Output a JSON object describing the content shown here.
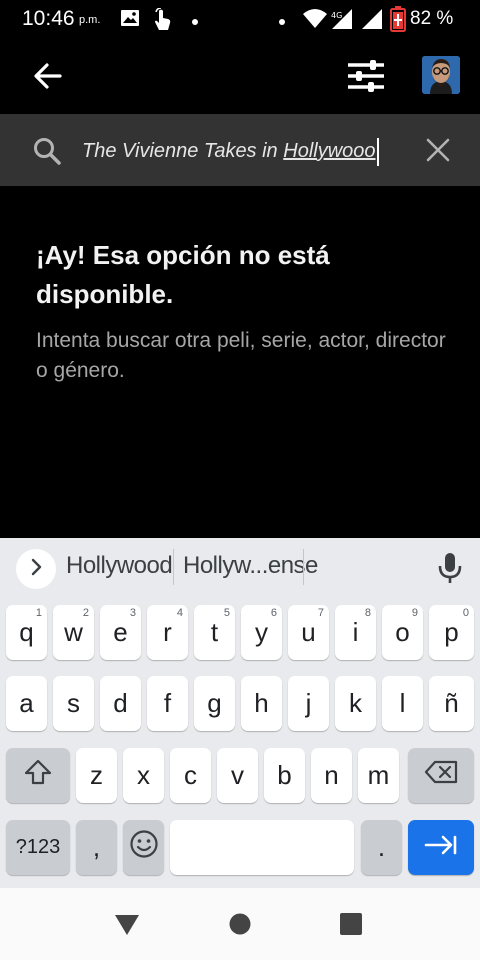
{
  "status_bar": {
    "time": "10:46",
    "ampm": "p.m.",
    "battery_percent": "82 %"
  },
  "header": {
    "back_icon": "arrow-back-icon",
    "filter_icon": "filter-sliders-icon",
    "avatar_icon": "profile-avatar"
  },
  "search": {
    "query_prefix": "The Vivienne Takes in ",
    "query_underlined": "Hollywooo"
  },
  "message": {
    "title": "¡Ay! Esa opción no está disponible.",
    "subtitle": "Intenta buscar otra peli, serie, actor, director o género."
  },
  "keyboard": {
    "suggestions": [
      "Hollywood",
      "Hollyw...ense"
    ],
    "row1": [
      {
        "label": "q",
        "hint": "1"
      },
      {
        "label": "w",
        "hint": "2"
      },
      {
        "label": "e",
        "hint": "3"
      },
      {
        "label": "r",
        "hint": "4"
      },
      {
        "label": "t",
        "hint": "5"
      },
      {
        "label": "y",
        "hint": "6"
      },
      {
        "label": "u",
        "hint": "7"
      },
      {
        "label": "i",
        "hint": "8"
      },
      {
        "label": "o",
        "hint": "9"
      },
      {
        "label": "p",
        "hint": "0"
      }
    ],
    "row2": [
      "a",
      "s",
      "d",
      "f",
      "g",
      "h",
      "j",
      "k",
      "l",
      "ñ"
    ],
    "row3": [
      "z",
      "x",
      "c",
      "v",
      "b",
      "n",
      "m"
    ],
    "symbols_label": "?123",
    "comma_label": ",",
    "period_label": "."
  },
  "colors": {
    "accent_blue": "#1a73e8",
    "search_bar_bg": "#333333",
    "keyboard_bg": "#e8eaed"
  }
}
